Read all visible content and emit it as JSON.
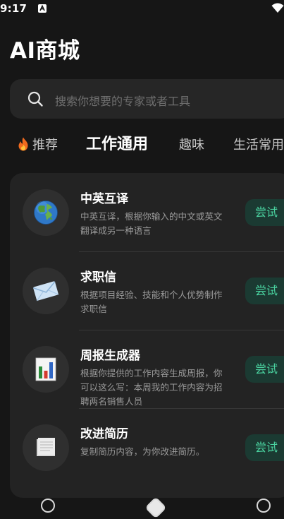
{
  "status_bar": {
    "time": "9:17"
  },
  "page_title": "AI商城",
  "search": {
    "placeholder": "搜索你想要的专家或者工具"
  },
  "tabs": [
    {
      "label": "推荐",
      "icon": "fire-icon"
    },
    {
      "label": "工作通用",
      "selected": true
    },
    {
      "label": "趣味"
    },
    {
      "label": "生活常用"
    }
  ],
  "items": [
    {
      "title": "中英互译",
      "description": "中英互译，根据你输入的中文或英文翻译成另一种语言",
      "icon": "globe-icon",
      "action": "尝试"
    },
    {
      "title": "求职信",
      "description": "根据项目经验、技能和个人优势制作求职信",
      "icon": "envelope-icon",
      "action": "尝试"
    },
    {
      "title": "周报生成器",
      "description": "根据你提供的工作内容生成周报，你可以这么写：本周我的工作内容为招聘两名销售人员",
      "icon": "bar-chart-icon",
      "action": "尝试"
    },
    {
      "title": "改进简历",
      "description": "复制简历内容，为你改进简历。",
      "icon": "document-icon",
      "action": "尝试"
    }
  ],
  "colors": {
    "background": "#161616",
    "card": "#232323",
    "accent": "#4ad3a0",
    "accent_bg": "#1b3a32"
  }
}
